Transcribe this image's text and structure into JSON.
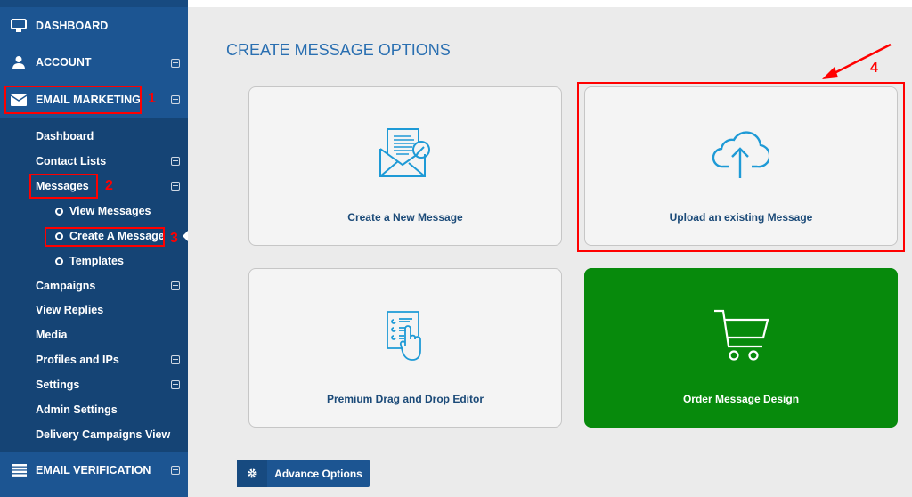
{
  "sidebar": {
    "main_items": [
      {
        "label": "DASHBOARD",
        "icon": "monitor-icon"
      },
      {
        "label": "ACCOUNT",
        "icon": "user-icon"
      },
      {
        "label": "EMAIL MARKETING",
        "icon": "envelope-icon"
      },
      {
        "label": "EMAIL VERIFICATION",
        "icon": "list-icon"
      }
    ],
    "sub_items": [
      "Dashboard",
      "Contact Lists",
      "Messages",
      "Campaigns",
      "View Replies",
      "Media",
      "Profiles and IPs",
      "Settings",
      "Admin Settings",
      "Delivery Campaigns View"
    ],
    "message_items": [
      "View Messages",
      "Create A Message",
      "Templates"
    ],
    "active_item": "Create A Message"
  },
  "main": {
    "title": "CREATE MESSAGE OPTIONS",
    "cards": [
      {
        "label": "Create a New Message",
        "icon": "envelope-letter-edit-icon"
      },
      {
        "label": "Upload an existing Message",
        "icon": "cloud-upload-icon"
      },
      {
        "label": "Premium Drag and Drop Editor",
        "icon": "checklist-hand-icon"
      },
      {
        "label": "Order Message Design",
        "icon": "shopping-cart-icon"
      }
    ],
    "advance_button": "Advance Options"
  },
  "annotations": [
    "1",
    "2",
    "3",
    "4"
  ],
  "colors": {
    "sidebar": "#1c5592",
    "sidebar_sub": "#154475",
    "accent_blue": "#2a6fb1",
    "icon_blue": "#1e9ad6",
    "green": "#078a0c",
    "annotation": "#ff0000"
  }
}
